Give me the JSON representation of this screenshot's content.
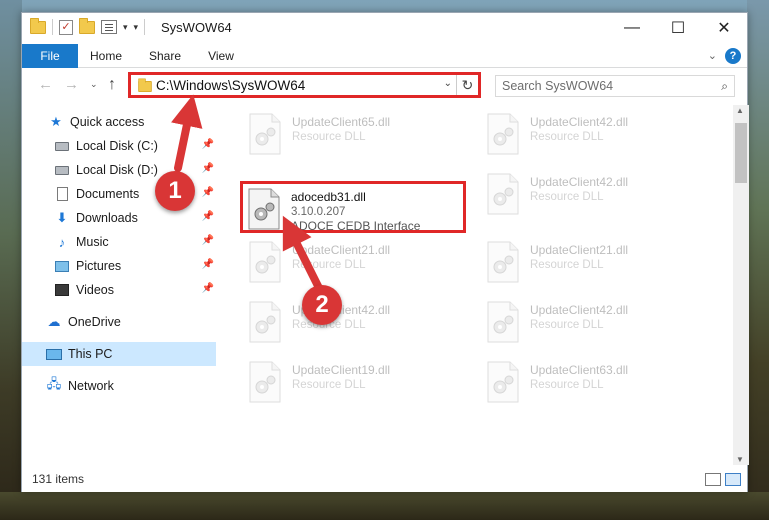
{
  "window": {
    "title": "SysWOW64",
    "buttons": {
      "minimize": "—",
      "maximize": "☐",
      "close": "✕"
    }
  },
  "ribbon": {
    "tabs": [
      "File",
      "Home",
      "Share",
      "View"
    ],
    "expand_glyph": "⌄",
    "help_glyph": "?"
  },
  "navbar": {
    "back": "←",
    "forward": "→",
    "recent": "⌄",
    "up": "↑",
    "address": "C:\\Windows\\SysWOW64",
    "address_dropdown": "⌄",
    "refresh": "↻",
    "search_placeholder": "Search SysWOW64",
    "search_glyph": "⌕"
  },
  "nav_pane": {
    "items": [
      {
        "label": "Quick access",
        "icon": "star-icon",
        "pinned": false
      },
      {
        "label": "Local Disk (C:)",
        "icon": "disk-icon",
        "pinned": true
      },
      {
        "label": "Local Disk (D:)",
        "icon": "disk-icon",
        "pinned": true
      },
      {
        "label": "Documents",
        "icon": "document-icon",
        "pinned": true
      },
      {
        "label": "Downloads",
        "icon": "download-icon",
        "pinned": true
      },
      {
        "label": "Music",
        "icon": "music-icon",
        "pinned": true
      },
      {
        "label": "Pictures",
        "icon": "pictures-icon",
        "pinned": true
      },
      {
        "label": "Videos",
        "icon": "videos-icon",
        "pinned": true
      },
      {
        "label": "OneDrive",
        "icon": "cloud-icon",
        "pinned": false
      },
      {
        "label": "This PC",
        "icon": "computer-icon",
        "pinned": false,
        "selected": true
      },
      {
        "label": "Network",
        "icon": "network-icon",
        "pinned": false
      }
    ]
  },
  "files": {
    "left": [
      {
        "name": "UpdateClient65.dll",
        "desc": "Resource DLL",
        "faded": true
      },
      {
        "name": "adocedb31.dll",
        "desc": "3.10.0.207",
        "desc2": "ADOCE CEDB Interface",
        "faded": false,
        "highlighted": true
      },
      {
        "name": "UpdateClient21.dll",
        "desc": "Resource DLL",
        "faded": true
      },
      {
        "name": "UpdateClient42.dll",
        "desc": "Resource DLL",
        "faded": true
      },
      {
        "name": "UpdateClient19.dll",
        "desc": "Resource DLL",
        "faded": true
      }
    ],
    "right": [
      {
        "name": "UpdateClient42.dll",
        "desc": "Resource DLL",
        "faded": true
      },
      {
        "name": "UpdateClient42.dll",
        "desc": "Resource DLL",
        "faded": true
      },
      {
        "name": "UpdateClient21.dll",
        "desc": "Resource DLL",
        "faded": true
      },
      {
        "name": "UpdateClient42.dll",
        "desc": "Resource DLL",
        "faded": true
      },
      {
        "name": "UpdateClient63.dll",
        "desc": "Resource DLL",
        "faded": true
      }
    ]
  },
  "status": {
    "item_count": "131 items"
  },
  "annotations": {
    "step1": "1",
    "step2": "2"
  },
  "colors": {
    "accent": "#1979ca",
    "highlight": "#e02727",
    "callout": "#d93636",
    "selection": "#cce8ff"
  }
}
